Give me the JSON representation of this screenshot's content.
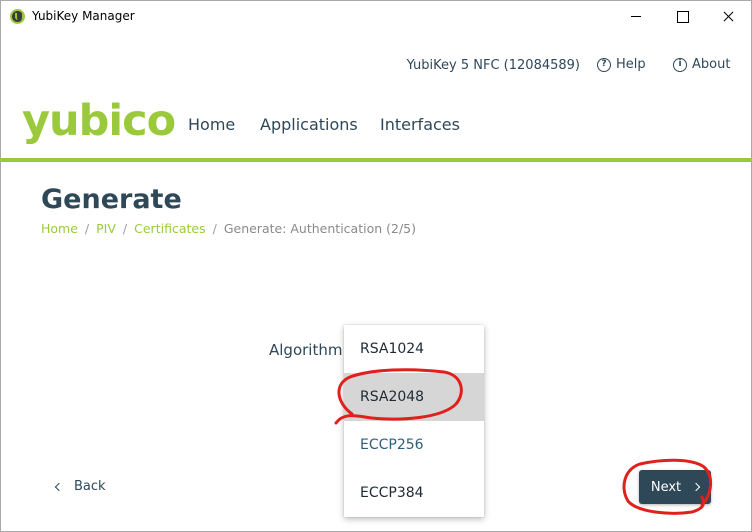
{
  "window": {
    "title": "YubiKey Manager"
  },
  "header": {
    "device": "YubiKey 5 NFC (12084589)",
    "help_label": "Help",
    "about_label": "About",
    "logo": "yubico",
    "nav": [
      "Home",
      "Applications",
      "Interfaces"
    ]
  },
  "page": {
    "title": "Generate",
    "breadcrumb": {
      "links": [
        "Home",
        "PIV",
        "Certificates"
      ],
      "current": "Generate: Authentication (2/5)"
    },
    "algorithm_label": "Algorithm",
    "algorithm_options": [
      "RSA1024",
      "RSA2048",
      "ECCP256",
      "ECCP384"
    ],
    "selected_option": "RSA2048"
  },
  "footer": {
    "back_label": "Back",
    "next_label": "Next"
  },
  "colors": {
    "brand_green": "#9aca3c",
    "navy": "#2f4858",
    "annotation_red": "#e0201c"
  }
}
